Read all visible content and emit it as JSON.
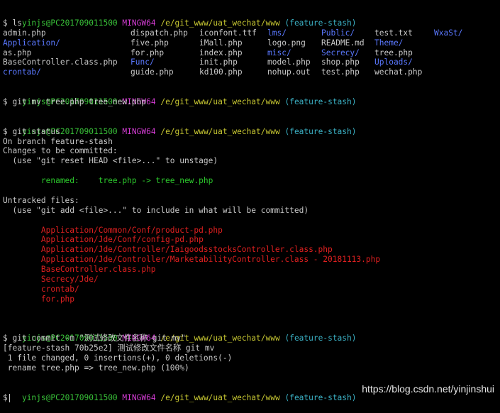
{
  "colors": {
    "background": "#000000",
    "text": "#c8c8c8",
    "user": "#39c339",
    "mingw": "#d23cd2",
    "path": "#c8c832",
    "branch": "#3cb4c8",
    "dir": "#5a78ff",
    "green": "#2cc82c",
    "red": "#e02020"
  },
  "prompt": {
    "user": "yinjs@PC201709011500",
    "env": "MINGW64",
    "path": "/e/git_www/uat_wechat/www",
    "branch": "(feature-stash)",
    "dollar": "$"
  },
  "ls": {
    "command": "$ ls",
    "rows": [
      [
        {
          "t": "admin.php",
          "d": false
        },
        {
          "t": "dispatch.php",
          "d": false
        },
        {
          "t": "iconfont.ttf",
          "d": false
        },
        {
          "t": "lms/",
          "d": true
        },
        {
          "t": "Public/",
          "d": true
        },
        {
          "t": "test.txt",
          "d": false
        },
        {
          "t": "WxaSt/",
          "d": true
        }
      ],
      [
        {
          "t": "Application/",
          "d": true
        },
        {
          "t": "five.php",
          "d": false
        },
        {
          "t": "iMall.php",
          "d": false
        },
        {
          "t": "logo.png",
          "d": false
        },
        {
          "t": "README.md",
          "d": false
        },
        {
          "t": "Theme/",
          "d": true
        }
      ],
      [
        {
          "t": "as.php",
          "d": false
        },
        {
          "t": "for.php",
          "d": false
        },
        {
          "t": "index.php",
          "d": false
        },
        {
          "t": "misc/",
          "d": true
        },
        {
          "t": "Secrecy/",
          "d": true
        },
        {
          "t": "tree.php",
          "d": false
        }
      ],
      [
        {
          "t": "BaseController.class.php",
          "d": false
        },
        {
          "t": "Func/",
          "d": true
        },
        {
          "t": "init.php",
          "d": false
        },
        {
          "t": "model.php",
          "d": false
        },
        {
          "t": "shop.php",
          "d": false
        },
        {
          "t": "Uploads/",
          "d": true
        }
      ],
      [
        {
          "t": "crontab/",
          "d": true
        },
        {
          "t": "guide.php",
          "d": false
        },
        {
          "t": "kd100.php",
          "d": false
        },
        {
          "t": "nohup.out",
          "d": false
        },
        {
          "t": "test.php",
          "d": false
        },
        {
          "t": "wechat.php",
          "d": false
        }
      ]
    ]
  },
  "mv": {
    "command": "$ git mv tree.php tree_new.php"
  },
  "status": {
    "command": "$ git status",
    "on_branch": "On branch feature-stash",
    "changes_header": "Changes to be committed:",
    "unstage_hint": "  (use \"git reset HEAD <file>...\" to unstage)",
    "renamed": "        renamed:    tree.php -> tree_new.php",
    "untracked_header": "Untracked files:",
    "add_hint": "  (use \"git add <file>...\" to include in what will be committed)",
    "untracked": [
      "        Application/Common/Conf/product-pd.php",
      "        Application/Jde/Conf/config-pd.php",
      "        Application/Jde/Controller/IaigoodsstocksController.class.php",
      "        Application/Jde/Controller/MarketabilityController.class - 20181113.php",
      "        BaseController.class.php",
      "        Secrecy/Jde/",
      "        crontab/",
      "        for.php"
    ]
  },
  "commit": {
    "command": "$ git commit -m \"测试修改文件名称 git mv\"",
    "result": "[feature-stash 70b25e2] 测试修改文件名称 git mv",
    "summary": " 1 file changed, 0 insertions(+), 0 deletions(-)",
    "rename": " rename tree.php => tree_new.php (100%)"
  },
  "watermark": "https://blog.csdn.net/yinjinshui"
}
